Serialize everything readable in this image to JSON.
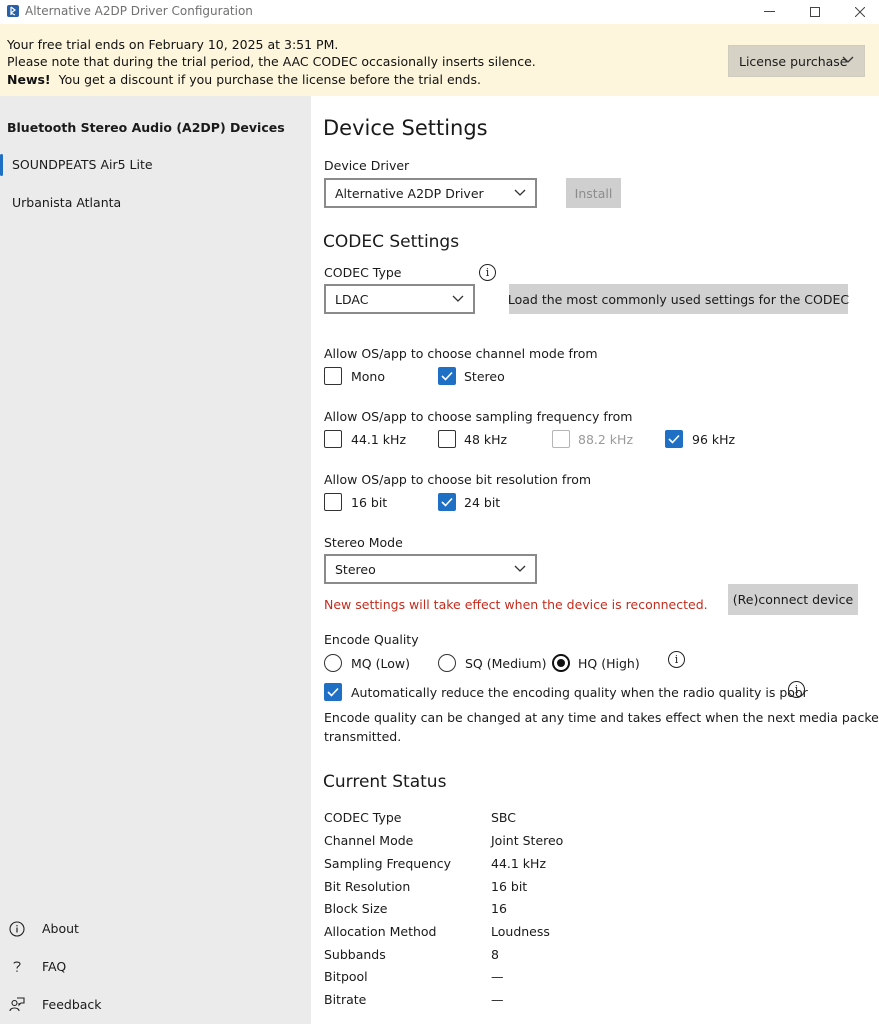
{
  "window": {
    "title": "Alternative A2DP Driver Configuration"
  },
  "banner": {
    "line1": "Your free trial ends on February 10, 2025 at 3:51 PM.",
    "line2": "Please note that during the trial period, the AAC CODEC occasionally inserts silence.",
    "news_label": "News!",
    "news_text": "You get a discount if you purchase the license before the trial ends.",
    "license_button": "License purchase"
  },
  "sidebar": {
    "header": "Bluetooth Stereo Audio (A2DP) Devices",
    "devices": [
      {
        "label": "SOUNDPEATS Air5 Lite",
        "selected": true
      },
      {
        "label": "Urbanista Atlanta",
        "selected": false
      }
    ],
    "footer": {
      "about": "About",
      "faq": "FAQ",
      "feedback": "Feedback"
    }
  },
  "device_settings": {
    "title": "Device Settings",
    "driver_label": "Device Driver",
    "driver_value": "Alternative A2DP Driver",
    "install_button": "Install"
  },
  "codec_settings": {
    "title": "CODEC Settings",
    "codec_type_label": "CODEC Type",
    "codec_type_value": "LDAC",
    "load_button": "Load the most commonly used settings for the CODEC",
    "channel_mode_label": "Allow OS/app to choose channel mode from",
    "channel_modes": [
      {
        "label": "Mono",
        "checked": false
      },
      {
        "label": "Stereo",
        "checked": true
      }
    ],
    "sampling_label": "Allow OS/app to choose sampling frequency from",
    "sampling": [
      {
        "label": "44.1 kHz",
        "checked": false,
        "disabled": false
      },
      {
        "label": "48 kHz",
        "checked": false,
        "disabled": false
      },
      {
        "label": "88.2 kHz",
        "checked": false,
        "disabled": true
      },
      {
        "label": "96 kHz",
        "checked": true,
        "disabled": false
      }
    ],
    "bitres_label": "Allow OS/app to choose bit resolution from",
    "bitres": [
      {
        "label": "16 bit",
        "checked": false
      },
      {
        "label": "24 bit",
        "checked": true
      }
    ],
    "stereo_mode_label": "Stereo Mode",
    "stereo_mode_value": "Stereo",
    "reconnect_warning": "New settings will take effect when the device is reconnected.",
    "reconnect_button": "(Re)connect device",
    "encode_quality_label": "Encode Quality",
    "encode_quality": [
      {
        "label": "MQ (Low)",
        "selected": false
      },
      {
        "label": "SQ (Medium)",
        "selected": false
      },
      {
        "label": "HQ (High)",
        "selected": true
      }
    ],
    "auto_reduce_label": "Automatically reduce the encoding quality when the radio quality is poor",
    "auto_reduce_checked": true,
    "encode_note_line1": "Encode quality can be changed at any time and takes effect when the next media packet is",
    "encode_note_line2": "transmitted."
  },
  "current_status": {
    "title": "Current Status",
    "rows": [
      {
        "key": "CODEC Type",
        "value": "SBC"
      },
      {
        "key": "Channel Mode",
        "value": "Joint Stereo"
      },
      {
        "key": "Sampling Frequency",
        "value": "44.1 kHz"
      },
      {
        "key": "Bit Resolution",
        "value": "16 bit"
      },
      {
        "key": "Block Size",
        "value": "16"
      },
      {
        "key": "Allocation Method",
        "value": "Loudness"
      },
      {
        "key": "Subbands",
        "value": "8"
      },
      {
        "key": "Bitpool",
        "value": "—"
      },
      {
        "key": "Bitrate",
        "value": "—"
      }
    ]
  },
  "colors": {
    "accent": "#1f6fc5",
    "warning": "#c42b1c",
    "banner_bg": "#fdf6dc",
    "sidebar_bg": "#ebebeb"
  }
}
